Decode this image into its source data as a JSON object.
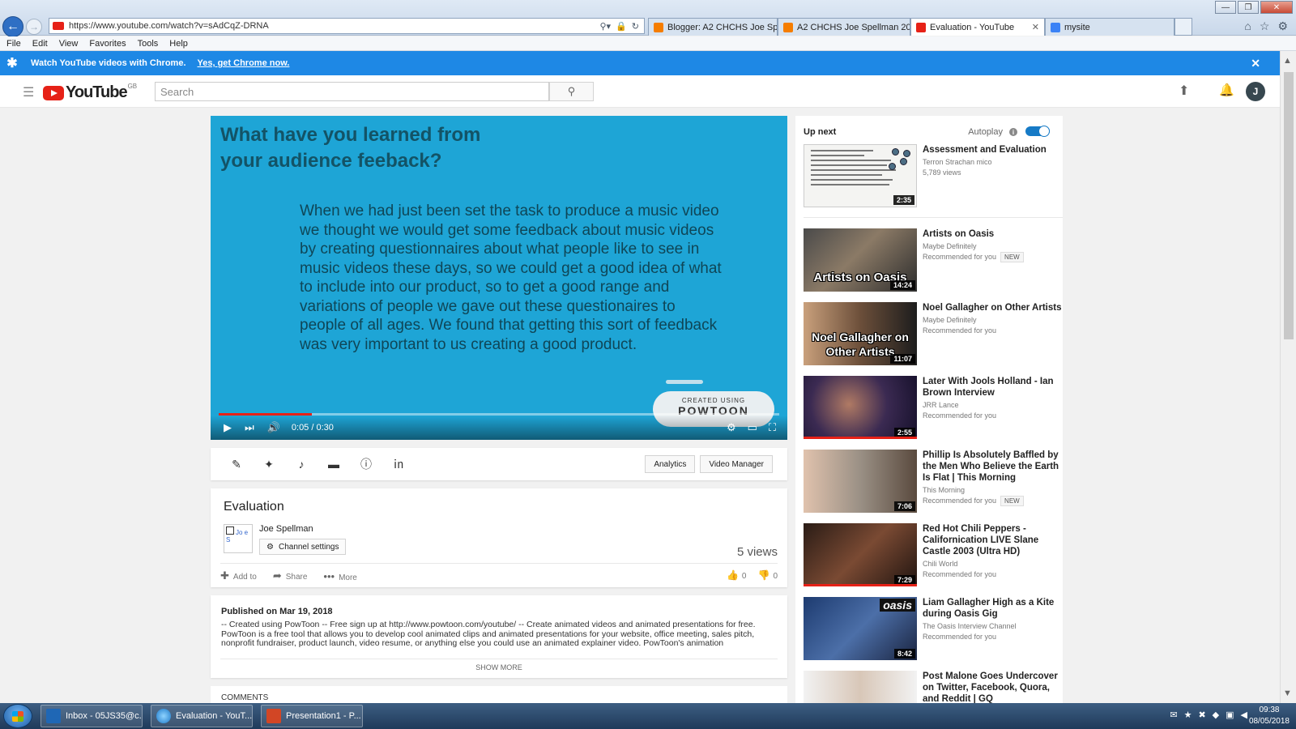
{
  "browser": {
    "url": "https://www.youtube.com/watch?v=sAdCqZ-DRNA",
    "tabs": [
      {
        "label": "Blogger: A2 CHCHS Joe Spell...",
        "icon": "blogger"
      },
      {
        "label": "A2 CHCHS Joe Spellman 2017/...",
        "icon": "blogger"
      },
      {
        "label": "Evaluation - YouTube",
        "icon": "yt",
        "active": true
      },
      {
        "label": "mysite",
        "icon": "site"
      }
    ],
    "menu": [
      "File",
      "Edit",
      "View",
      "Favorites",
      "Tools",
      "Help"
    ]
  },
  "banner": {
    "text": "Watch YouTube videos with Chrome.",
    "link": "Yes, get Chrome now."
  },
  "header": {
    "logo_text": "YouTube",
    "region": "GB",
    "search_placeholder": "Search",
    "avatar_letter": "J"
  },
  "player": {
    "slide_title": "What have you learned from your audience feeback?",
    "slide_body": "When we had just been set the task to produce a music video we thought we would get some feedback about music videos by creating questionnaires about what people like to see in music videos these days, so we could get a good idea of what to include into our product, so to get a good range and variations of people we gave out these questionaires to people of all ages. We found that getting this sort of feedback was very important to us creating a good product.",
    "badge_small": "CREATED USING",
    "badge_big": "POWTOON",
    "time": "0:05 / 0:30",
    "progress_fraction": 0.1667
  },
  "creator": {
    "analytics": "Analytics",
    "video_manager": "Video Manager"
  },
  "video": {
    "title": "Evaluation",
    "channel_thumb_text": "Jo e S",
    "channel": "Joe Spellman",
    "channel_settings": "Channel settings",
    "views": "5 views",
    "add_to": "Add to",
    "share": "Share",
    "more": "More",
    "likes": "0",
    "dislikes": "0",
    "published": "Published on Mar 19, 2018",
    "description": "-- Created using PowToon -- Free sign up at http://www.powtoon.com/youtube/ -- Create animated videos and animated presentations for free. PowToon is a free tool that allows you to develop cool animated clips and animated presentations for your website, office meeting, sales pitch, nonprofit fundraiser, product launch, video resume, or anything else you could use an animated explainer video. PowToon's animation",
    "show_more": "SHOW MORE",
    "comments": "COMMENTS"
  },
  "sidebar": {
    "up_next": "Up next",
    "autoplay": "Autoplay",
    "items": [
      {
        "title": "Assessment and Evaluation",
        "channel": "Terron Strachan mico",
        "meta": "5,789 views",
        "duration": "2:35",
        "thumb_text": "",
        "new": false
      },
      {
        "title": "Artists on Oasis",
        "channel": "Maybe Definitely",
        "meta": "Recommended for you",
        "duration": "14:24",
        "thumb_text": "Artists on Oasis",
        "new": true
      },
      {
        "title": "Noel Gallagher on Other Artists",
        "channel": "Maybe Definitely",
        "meta": "Recommended for you",
        "duration": "11:07",
        "thumb_text": "Noel Gallagher on Other Artists",
        "new": false
      },
      {
        "title": "Later With Jools Holland - Ian Brown Interview",
        "channel": "JRR Lance",
        "meta": "Recommended for you",
        "duration": "2:55",
        "thumb_text": "",
        "new": false
      },
      {
        "title": "Phillip Is Absolutely Baffled by the Men Who Believe the Earth Is Flat | This Morning",
        "channel": "This Morning",
        "meta": "Recommended for you",
        "duration": "7:06",
        "thumb_text": "",
        "new": true
      },
      {
        "title": "Red Hot Chili Peppers - Californication LIVE Slane Castle 2003 (Ultra HD)",
        "channel": "Chili World",
        "meta": "Recommended for you",
        "duration": "7:29",
        "thumb_text": "",
        "new": false
      },
      {
        "title": "Liam Gallagher High as a Kite during Oasis Gig",
        "channel": "The Oasis Interview Channel",
        "meta": "Recommended for you",
        "duration": "8:42",
        "thumb_text": "",
        "new": false,
        "tag": "oasis"
      },
      {
        "title": "Post Malone Goes Undercover on Twitter, Facebook, Quora, and Reddit | GQ",
        "channel": "",
        "meta": "",
        "duration": "",
        "thumb_text": "",
        "new": false
      }
    ],
    "new_label": "NEW"
  },
  "taskbar": {
    "items": [
      "Inbox - 05JS35@c...",
      "Evaluation - YouT...",
      "Presentation1 - P..."
    ],
    "time": "09:38",
    "date": "08/05/2018"
  },
  "colors": {
    "player_bg": "#1ea5d6",
    "yt_red": "#e62117",
    "banner_blue": "#1e88e5"
  }
}
